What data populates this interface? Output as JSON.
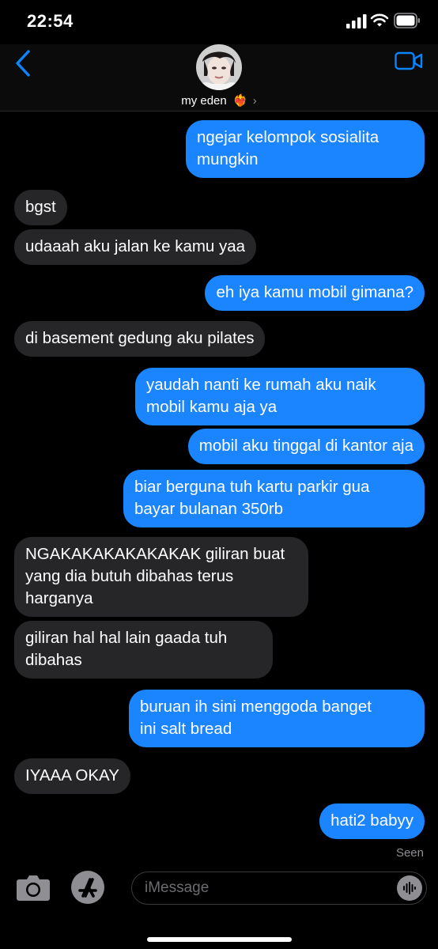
{
  "status": {
    "time": "22:54"
  },
  "header": {
    "contact_name": "my eden",
    "heart": "❤️‍🔥",
    "chevron": "›"
  },
  "messages": [
    {
      "dir": "out",
      "lines": [
        "ngejar kelompok sosialita",
        "mungkin"
      ]
    },
    {
      "dir": "in",
      "lines": [
        "bgst"
      ]
    },
    {
      "dir": "in",
      "lines": [
        "udaaah aku jalan ke kamu yaa"
      ]
    },
    {
      "dir": "out",
      "lines": [
        "eh iya kamu mobil gimana?"
      ]
    },
    {
      "dir": "in",
      "lines": [
        "di basement gedung aku pilates"
      ]
    },
    {
      "dir": "out",
      "lines": [
        "yaudah nanti ke rumah aku naik",
        "mobil kamu aja ya"
      ]
    },
    {
      "dir": "out",
      "lines": [
        "mobil aku tinggal di kantor aja"
      ]
    },
    {
      "dir": "out",
      "lines": [
        "biar berguna tuh kartu parkir gua",
        "bayar bulanan 350rb"
      ]
    },
    {
      "dir": "in",
      "lines": [
        "NGAKAKAKAKAKAKAK giliran buat",
        "yang dia butuh dibahas terus",
        "harganya"
      ]
    },
    {
      "dir": "in",
      "lines": [
        "giliran hal hal lain gaada tuh",
        "dibahas"
      ]
    },
    {
      "dir": "out",
      "lines": [
        "buruan ih sini menggoda banget",
        "ini salt bread"
      ]
    },
    {
      "dir": "in",
      "lines": [
        "IYAAA OKAY"
      ]
    },
    {
      "dir": "out",
      "lines": [
        "hati2 babyy"
      ]
    }
  ],
  "read_receipt": "Seen",
  "input": {
    "placeholder": "iMessage"
  },
  "icons": {
    "back": "chevron-left-icon",
    "video": "video-camera-icon",
    "camera": "camera-icon",
    "apps": "app-store-icon",
    "audio": "waveform-icon"
  },
  "colors": {
    "outgoing": "#1b84ff",
    "incoming": "#262628",
    "accent": "#0a84ff"
  }
}
